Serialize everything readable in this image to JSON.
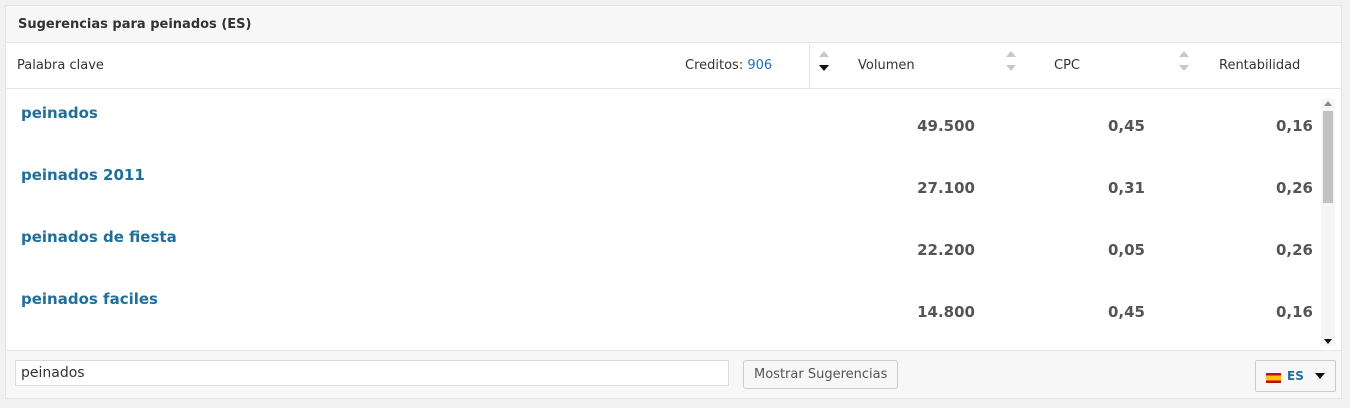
{
  "widget": {
    "title": "Sugerencias para peinados (ES)"
  },
  "header": {
    "keyword_label": "Palabra clave",
    "credits_label": "Creditos:",
    "credits_value": "906",
    "volume_label": "Volumen",
    "cpc_label": "CPC",
    "profit_label": "Rentabilidad"
  },
  "rows": [
    {
      "keyword": "peinados",
      "volume": "49.500",
      "cpc": "0,45",
      "profit": "0,16"
    },
    {
      "keyword": "peinados 2011",
      "volume": "27.100",
      "cpc": "0,31",
      "profit": "0,26"
    },
    {
      "keyword": "peinados de fiesta",
      "volume": "22.200",
      "cpc": "0,05",
      "profit": "0,26"
    },
    {
      "keyword": "peinados faciles",
      "volume": "14.800",
      "cpc": "0,45",
      "profit": "0,16"
    }
  ],
  "footer": {
    "search_value": "peinados",
    "button_label": "Mostrar Sugerencias",
    "language_code": "ES",
    "language_flag": "flag-spain-icon"
  },
  "colors": {
    "link": "#1f6f9a",
    "credits": "#2271b1"
  }
}
